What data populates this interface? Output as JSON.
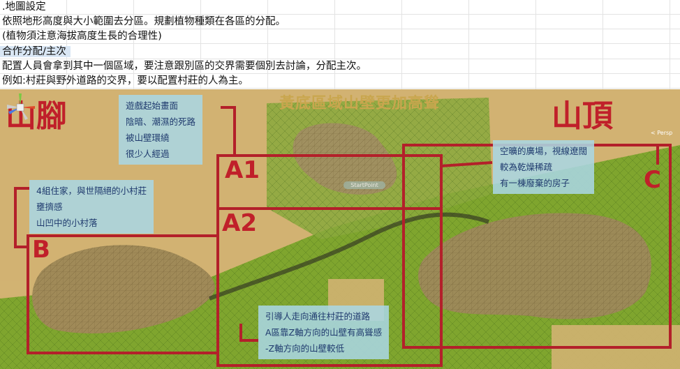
{
  "sheet": {
    "rows": [
      ".地圖設定",
      "依照地形高度與大小範圍去分區。規劃植物種類在各區的分配。",
      "(植物須注意海拔高度生長的合理性)",
      "合作分配/主次",
      "配置人員會拿到其中一個區域，要注意跟別區的交界需要個別去討論，分配主次。",
      "例如:村莊與野外道路的交界，要以配置村莊的人為主。"
    ]
  },
  "map": {
    "title_left": "山腳",
    "title_right": "山頂",
    "banner": "黃底區域山壁更加高聳",
    "spawn_label": "StartPoint",
    "gizmo_caption": "< Persp",
    "zones": {
      "a1": "A1",
      "a2": "A2",
      "b": "B",
      "c": "C"
    },
    "notes": {
      "a1": [
        "遊戲起始畫面",
        "陰暗、潮濕的死路",
        "被山壁環繞",
        "很少人經過"
      ],
      "b": [
        "4組住家，與世隔絕的小村莊",
        "壅擠感",
        "山凹中的小村落"
      ],
      "c": [
        "空曠的廣場，視線遼闊",
        "較為乾燥稀疏",
        "有一棟廢棄的房子"
      ],
      "road": [
        "引導人走向通往村莊的道路",
        "A區靠Z軸方向的山壁有高聳感",
        "-Z軸方向的山壁較低"
      ]
    },
    "colors": {
      "zone_border": "#b3202a",
      "sand": "#d2b272",
      "grass": "#7fa52e",
      "note_bg": "#aad6e2",
      "note_text": "#1f3a6e"
    }
  }
}
